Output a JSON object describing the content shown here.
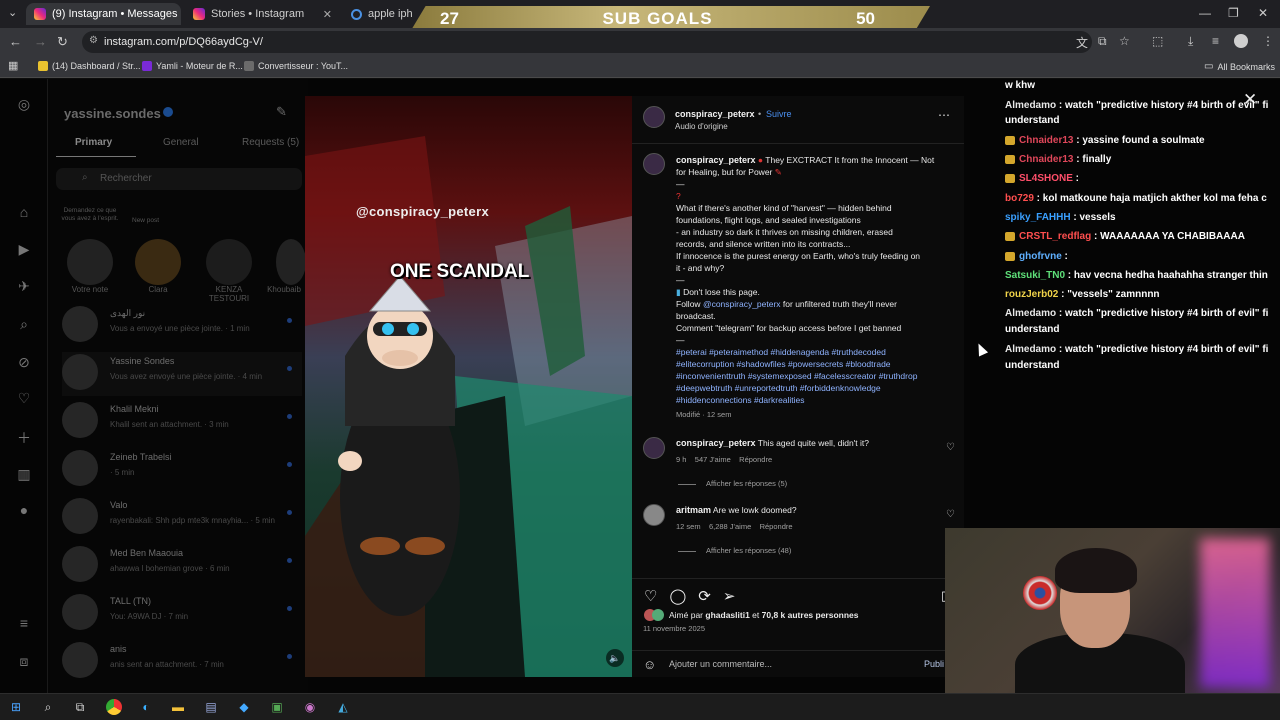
{
  "tabs": [
    {
      "title": "(9) Instagram • Messages",
      "active": true
    },
    {
      "title": "Stories • Instagram",
      "active": false
    },
    {
      "title": "apple iphone",
      "active": false
    }
  ],
  "sub_goals": {
    "left": "27",
    "label": "SUB GOALS",
    "right": "50"
  },
  "address": {
    "url": "instagram.com/p/DQ66aydCg-V/"
  },
  "bookmarks": [
    {
      "label": "(14) Dashboard / Str..."
    },
    {
      "label": "Yamli - Moteur de R..."
    },
    {
      "label": "Convertisseur : YouT..."
    }
  ],
  "bookmarks_all": "All Bookmarks",
  "dm": {
    "username": "yassine.sondes",
    "tabs": [
      "Primary",
      "General",
      "Requests (5)"
    ],
    "search_placeholder": "Rechercher",
    "stories": [
      {
        "note": "Demandez ce que vous avez à l'esprit.",
        "name": "Votre note"
      },
      {
        "note": "New post",
        "name": "Clara"
      },
      {
        "note": "",
        "name": "KENZA TESTOURI"
      },
      {
        "note": "",
        "name": "Khoubaib"
      }
    ],
    "conversations": [
      {
        "name": "نور الهدى",
        "preview": "Vous a envoyé une pièce jointe. · 1 min"
      },
      {
        "name": "Yassine Sondes",
        "preview": "Vous avez envoyé une pièce jointe. · 4 min"
      },
      {
        "name": "Khalil Mekni",
        "preview": "Khalil sent an attachment. · 3 min"
      },
      {
        "name": "Zeineb Trabelsi",
        "preview": "· 5 min"
      },
      {
        "name": "Valo",
        "preview": "rayenbakali: Shh pdp mte3k mnayhia... · 5 min"
      },
      {
        "name": "Med Ben Maaouia",
        "preview": "ahawwa l bohemian grove · 6 min"
      },
      {
        "name": "TALL (TN)",
        "preview": "You: A9WA DJ · 7 min"
      },
      {
        "name": "anis",
        "preview": "anis sent an attachment. · 7 min"
      }
    ]
  },
  "media": {
    "watermark": "@conspiracy_peterx",
    "caption": "ONE SCANDAL"
  },
  "post": {
    "author": "conspiracy_peterx",
    "follow": "Suivre",
    "audio": "Audio d'origine",
    "caption_first": "They EXCTRACT It from the Innocent — Not for Healing, but for Power",
    "caption_lines": [
      "—",
      "?",
      "What if there's another kind of \"harvest\" — hidden behind",
      "foundations, flight logs, and sealed investigations",
      "- an industry so dark it thrives on missing children, erased",
      "records, and silence written into its contracts...",
      "If innocence is the purest energy on Earth, who's truly feeding on",
      "it - and why?",
      "—",
      "Don't lose this page."
    ],
    "follow_line_pre": "Follow",
    "follow_line_handle": "@conspiracy_peterx",
    "follow_line_post": "for unfiltered truth they'll never",
    "broadcast": "broadcast.",
    "telegram_line": "Comment \"telegram\" for backup access before I get banned",
    "dash": "—",
    "hashtags": [
      "#peterai #peteraimethod #hiddenagenda #truthdecoded",
      "#elitecorruption #shadowfiles #powersecrets #bloodtrade",
      "#inconvenienttruth #systemexposed #facelesscreator #truthdrop",
      "#deepwebtruth #unreportedtruth #forbiddenknowledge",
      "#hiddenconnections #darkrealities"
    ],
    "modified": "Modifié · 12 sem",
    "comments": [
      {
        "user": "conspiracy_peterx",
        "text": "This aged quite well, didn't it?",
        "time": "9 h",
        "likes": "547 J'aime",
        "reply": "Répondre",
        "replies": "Afficher les réponses (5)"
      },
      {
        "user": "aritmam",
        "text": "Are we lowk doomed?",
        "time": "12 sem",
        "likes": "6,288 J'aime",
        "reply": "Répondre",
        "replies": "Afficher les réponses (48)"
      }
    ],
    "liked_by_pre": "Aimé par",
    "liked_by_user": "ghadasliti1",
    "liked_by_mid": "et",
    "liked_by_count": "70,8 k autres personnes",
    "date": "11 novembre 2025",
    "comment_placeholder": "Ajouter un commentaire...",
    "publish": "Publi"
  },
  "chat": [
    {
      "name": "",
      "color": "#ffffff",
      "text": "w khw",
      "badge": false
    },
    {
      "name": "Almedamo",
      "color": "#e8e8e8",
      "text": "watch \"predictive history #4 birth of evil\" fi",
      "badge": false
    },
    {
      "name": "",
      "color": "#ffffff",
      "text": "understand",
      "badge": false
    },
    {
      "name": "Chnaider13",
      "color": "#e0475a",
      "text": "yassine found a soulmate",
      "badge": true
    },
    {
      "name": "Chnaider13",
      "color": "#e0475a",
      "text": "finally",
      "badge": true
    },
    {
      "name": "SL4SHONE",
      "color": "#ff4f6a",
      "text": "",
      "badge": true
    },
    {
      "name": "bo729",
      "color": "#ff4f4f",
      "text": "kol matkoune haja matjich akther kol ma feha c",
      "badge": false
    },
    {
      "name": "spiky_FAHHH",
      "color": "#3aa0ff",
      "text": "vessels",
      "badge": false
    },
    {
      "name": "CRSTL_redflag",
      "color": "#ff4f4f",
      "text": "WAAAAAAA YA CHABIBAAAA",
      "badge": true
    },
    {
      "name": "ghofrvne",
      "color": "#5fb0ff",
      "text": "",
      "badge": true
    },
    {
      "name": "Satsuki_TN0",
      "color": "#5fe07a",
      "text": "hav vecna hedha haahahha stranger thin",
      "badge": false
    },
    {
      "name": "rouzJerb02",
      "color": "#f0d34a",
      "text": "\"vessels\" zamnnnn",
      "badge": false
    },
    {
      "name": "Almedamo",
      "color": "#e8e8e8",
      "text": "watch \"predictive history #4 birth of evil\" fi",
      "badge": false
    },
    {
      "name": "",
      "color": "#ffffff",
      "text": "understand",
      "badge": false
    },
    {
      "name": "Almedamo",
      "color": "#e8e8e8",
      "text": "watch \"predictive history #4 birth of evil\" fi",
      "badge": false
    },
    {
      "name": "",
      "color": "#ffffff",
      "text": "understand",
      "badge": false
    }
  ],
  "colors": {
    "accent": "#4a8ff0",
    "link": "#8fb3ff",
    "subgoal_bar": "#c7b77a"
  },
  "icons": {
    "close": "close-icon",
    "like": "heart-icon",
    "comment": "comment-icon",
    "repost": "repost-icon",
    "share": "send-icon",
    "more": "more-icon"
  }
}
